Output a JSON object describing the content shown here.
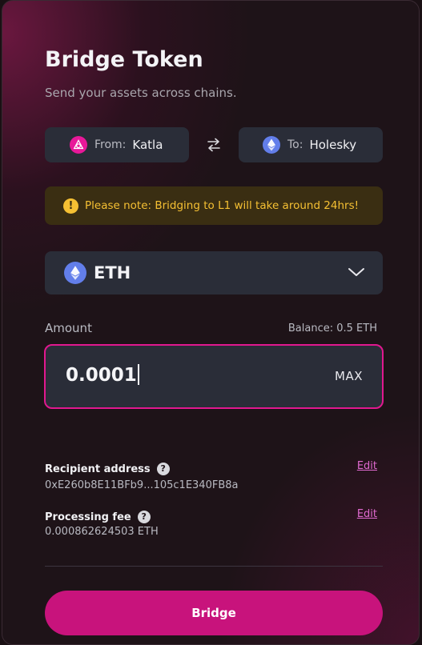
{
  "header": {
    "title": "Bridge Token",
    "subtitle": "Send your assets across chains."
  },
  "chains": {
    "from": {
      "prefix": "From:",
      "name": "Katla",
      "icon": "katla-logo-icon"
    },
    "to": {
      "prefix": "To:",
      "name": "Holesky",
      "icon": "ethereum-icon"
    },
    "swap_icon": "swap-arrows-icon"
  },
  "notice": {
    "icon": "exclamation-icon",
    "text": "Please note: Bridging to L1 will take around 24hrs!"
  },
  "token": {
    "selected": "ETH",
    "icon": "ethereum-icon"
  },
  "amount": {
    "label": "Amount",
    "balance": "Balance: 0.5 ETH",
    "value": "0.0001",
    "max_label": "MAX"
  },
  "recipient": {
    "label": "Recipient address",
    "value": "0xE260b8E11BFb9...105c1E340FB8a",
    "edit_label": "Edit"
  },
  "fee": {
    "label": "Processing fee",
    "value": "0.000862624503 ETH",
    "edit_label": "Edit"
  },
  "actions": {
    "bridge_label": "Bridge"
  },
  "colors": {
    "accent": "#e1188f",
    "button": "#c8137c",
    "warning": "#f5c033",
    "link": "#e06ad0"
  }
}
